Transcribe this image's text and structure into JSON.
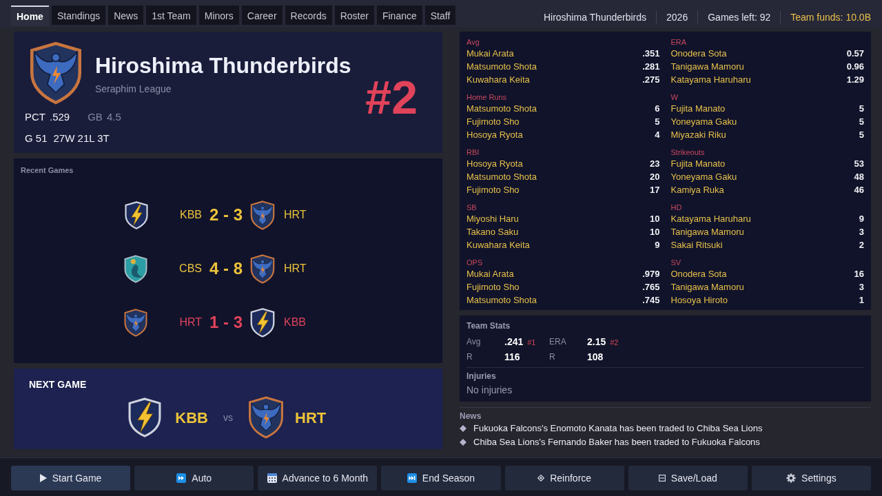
{
  "tabs": [
    {
      "label": "Home",
      "selected": true
    },
    {
      "label": "Standings",
      "selected": false
    },
    {
      "label": "News",
      "selected": false
    },
    {
      "label": "1st Team",
      "selected": false
    },
    {
      "label": "Minors",
      "selected": false
    },
    {
      "label": "Career",
      "selected": false
    },
    {
      "label": "Records",
      "selected": false
    },
    {
      "label": "Roster",
      "selected": false
    },
    {
      "label": "Finance",
      "selected": false
    },
    {
      "label": "Staff",
      "selected": false
    }
  ],
  "header": {
    "team": "Hiroshima Thunderbirds",
    "year": "2026",
    "games_left": "Games left: 92",
    "funds": "Team funds: 10.0B"
  },
  "team_card": {
    "crest": {
      "kind": "bird"
    },
    "name": "Hiroshima Thunderbirds",
    "league": "Seraphim League",
    "pct_label": "PCT",
    "pct": ".529",
    "gb_label": "GB",
    "gb": "4.5",
    "games": "G 51",
    "record": "27W 21L 3T",
    "rank": "#2"
  },
  "recent_games": {
    "title": "Recent Games",
    "games": [
      {
        "home": {
          "kind": "bolt",
          "abbr": "KBB"
        },
        "score": "2 - 3",
        "away": {
          "kind": "bird",
          "abbr": "HRT"
        },
        "color": "#ecc33a"
      },
      {
        "home": {
          "kind": "seal",
          "abbr": "CBS"
        },
        "score": "4 - 8",
        "away": {
          "kind": "bird",
          "abbr": "HRT"
        },
        "color": "#ecc33a"
      },
      {
        "home": {
          "kind": "bird",
          "abbr": "HRT"
        },
        "score": "1 - 3",
        "away": {
          "kind": "bolt",
          "abbr": "KBB"
        },
        "color": "#e0435a"
      }
    ]
  },
  "next_game": {
    "title": "NEXT GAME",
    "home": {
      "kind": "bolt",
      "abbr": "KBB"
    },
    "vs": "vs",
    "away": {
      "kind": "bird",
      "abbr": "HRT"
    }
  },
  "leaders": [
    {
      "title": "Avg",
      "rows": [
        {
          "name": "Mukai Arata",
          "value": ".351"
        },
        {
          "name": "Matsumoto Shota",
          "value": ".281"
        },
        {
          "name": "Kuwahara Keita",
          "value": ".275"
        }
      ]
    },
    {
      "title": "ERA",
      "rows": [
        {
          "name": "Onodera Sota",
          "value": "0.57"
        },
        {
          "name": "Tanigawa Mamoru",
          "value": "0.96"
        },
        {
          "name": "Katayama Haruharu",
          "value": "1.29"
        }
      ]
    },
    {
      "title": "Home Runs",
      "rows": [
        {
          "name": "Matsumoto Shota",
          "value": "6"
        },
        {
          "name": "Fujimoto Sho",
          "value": "5"
        },
        {
          "name": "Hosoya Ryota",
          "value": "4"
        }
      ]
    },
    {
      "title": "W",
      "rows": [
        {
          "name": "Fujita Manato",
          "value": "5"
        },
        {
          "name": "Yoneyama Gaku",
          "value": "5"
        },
        {
          "name": "Miyazaki Riku",
          "value": "5"
        }
      ]
    },
    {
      "title": "RBI",
      "rows": [
        {
          "name": "Hosoya Ryota",
          "value": "23"
        },
        {
          "name": "Matsumoto Shota",
          "value": "20"
        },
        {
          "name": "Fujimoto Sho",
          "value": "17"
        }
      ]
    },
    {
      "title": "Strikeouts",
      "rows": [
        {
          "name": "Fujita Manato",
          "value": "53"
        },
        {
          "name": "Yoneyama Gaku",
          "value": "48"
        },
        {
          "name": "Kamiya Ruka",
          "value": "46"
        }
      ]
    },
    {
      "title": "SB",
      "rows": [
        {
          "name": "Miyoshi Haru",
          "value": "10"
        },
        {
          "name": "Takano Saku",
          "value": "10"
        },
        {
          "name": "Kuwahara Keita",
          "value": "9"
        }
      ]
    },
    {
      "title": "HD",
      "rows": [
        {
          "name": "Katayama Haruharu",
          "value": "9"
        },
        {
          "name": "Tanigawa Mamoru",
          "value": "3"
        },
        {
          "name": "Sakai Ritsuki",
          "value": "2"
        }
      ]
    },
    {
      "title": "OPS",
      "rows": [
        {
          "name": "Mukai Arata",
          "value": ".979"
        },
        {
          "name": "Fujimoto Sho",
          "value": ".765"
        },
        {
          "name": "Matsumoto Shota",
          "value": ".745"
        }
      ]
    },
    {
      "title": "SV",
      "rows": [
        {
          "name": "Onodera Sota",
          "value": "16"
        },
        {
          "name": "Tanigawa Mamoru",
          "value": "3"
        },
        {
          "name": "Hosoya Hiroto",
          "value": "1"
        }
      ]
    }
  ],
  "team_stats": {
    "title": "Team Stats",
    "items": [
      {
        "label": "Avg",
        "value": ".241",
        "rank": "#1"
      },
      {
        "label": "ERA",
        "value": "2.15",
        "rank": "#2"
      },
      {
        "label": "R",
        "value": "116"
      },
      {
        "label": "R",
        "value": "108"
      }
    ]
  },
  "injuries": {
    "title": "Injuries",
    "text": "No injuries"
  },
  "news": {
    "title": "News",
    "items": [
      "Fukuoka Falcons's Enomoto Kanata has been traded to Chiba Sea Lions",
      "Chiba Sea Lions's Fernando Baker has been traded to Fukuoka Falcons"
    ]
  },
  "actions": [
    {
      "label": "Start Game",
      "kind": "play",
      "highlighted": true
    },
    {
      "label": "Auto",
      "kind": "fast-forward",
      "highlighted": false
    },
    {
      "label": "Advance to 6 Month",
      "kind": "calendar",
      "highlighted": false
    },
    {
      "label": "End Season",
      "kind": "skip",
      "highlighted": false
    },
    {
      "label": "Reinforce",
      "kind": "diamond",
      "highlighted": false
    },
    {
      "label": "Save/Load",
      "kind": "save",
      "highlighted": false
    },
    {
      "label": "Settings",
      "kind": "gear",
      "highlighted": false
    }
  ]
}
